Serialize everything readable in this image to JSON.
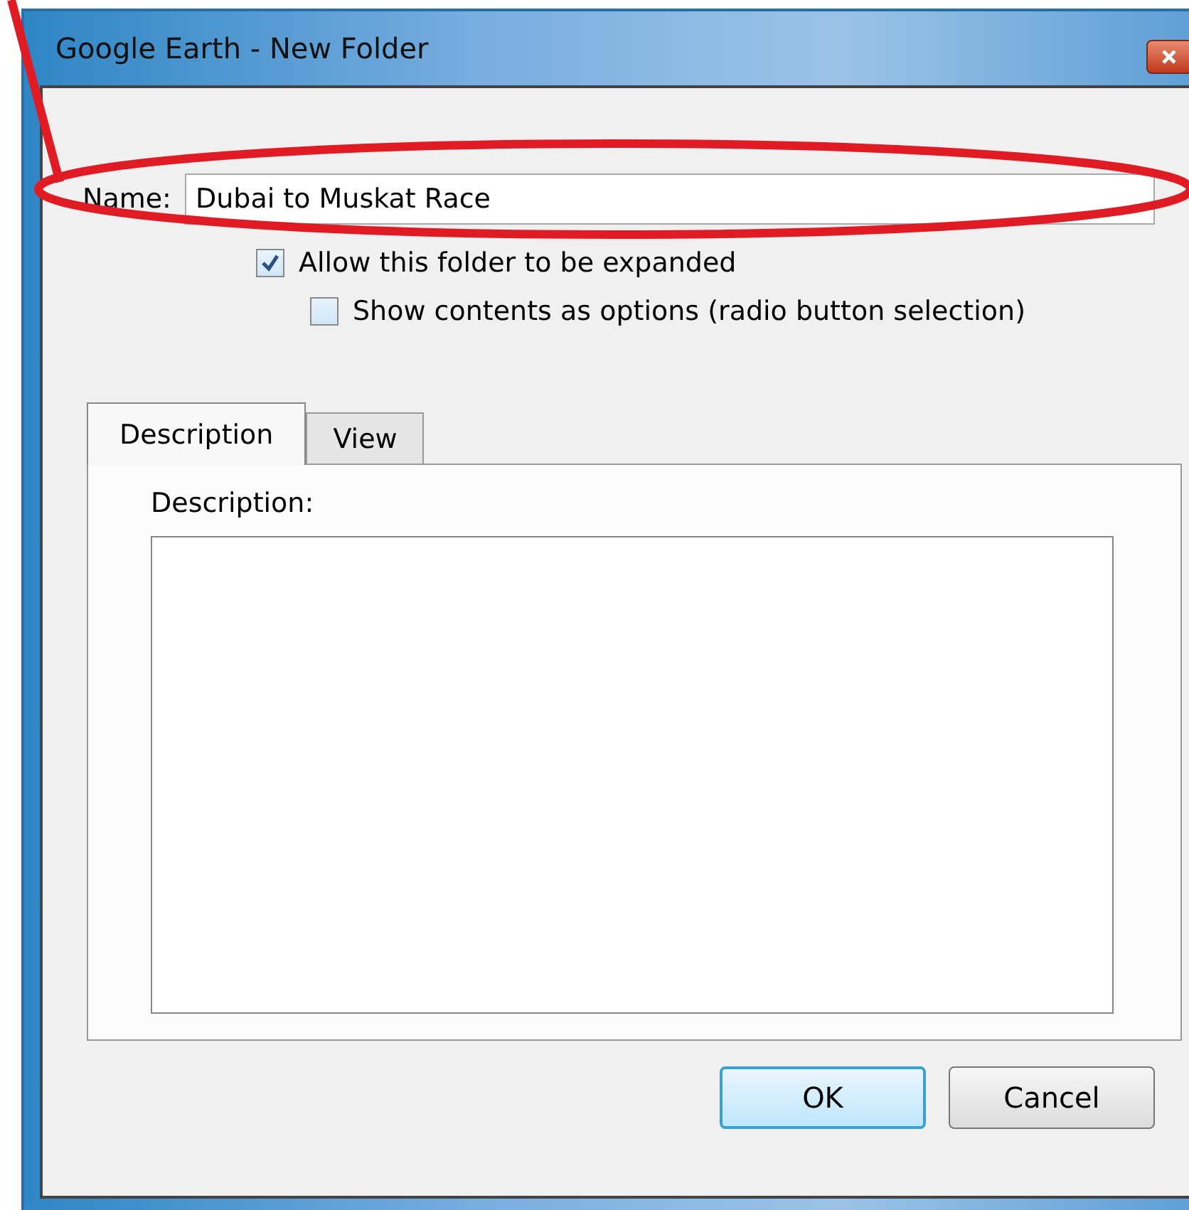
{
  "window": {
    "title": "Google Earth - New Folder"
  },
  "name_field": {
    "label": "Name:",
    "value": "Dubai to Muskat Race"
  },
  "options": [
    {
      "label": "Allow this folder to be expanded",
      "checked": true
    },
    {
      "label": "Show contents as options (radio button selection)",
      "checked": false
    }
  ],
  "tabs": [
    {
      "label": "Description",
      "selected": true
    },
    {
      "label": "View",
      "selected": false
    }
  ],
  "description": {
    "label": "Description:"
  },
  "buttons": [
    {
      "label": "OK",
      "default": true
    },
    {
      "label": "Cancel",
      "default": false
    }
  ]
}
